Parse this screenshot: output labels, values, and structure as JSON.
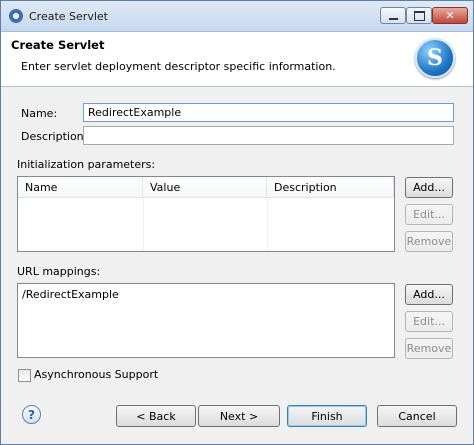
{
  "window": {
    "title": "Create Servlet",
    "close_glyph": "✕"
  },
  "banner": {
    "title": "Create Servlet",
    "description": "Enter servlet deployment descriptor specific information.",
    "logo_letter": "S"
  },
  "form": {
    "name_label": "Name:",
    "name_value": "RedirectExample",
    "description_label": "Description:",
    "description_value": ""
  },
  "init_params": {
    "label": "Initialization parameters:",
    "columns": [
      "Name",
      "Value",
      "Description"
    ],
    "rows": [],
    "add_label": "Add...",
    "edit_label": "Edit...",
    "remove_label": "Remove"
  },
  "url_mappings": {
    "label": "URL mappings:",
    "items": [
      "/RedirectExample"
    ],
    "add_label": "Add...",
    "edit_label": "Edit...",
    "remove_label": "Remove"
  },
  "async": {
    "label": "Asynchronous Support",
    "checked": false
  },
  "footer": {
    "help_glyph": "?",
    "back_label": "< Back",
    "next_label": "Next >",
    "finish_label": "Finish",
    "cancel_label": "Cancel"
  }
}
